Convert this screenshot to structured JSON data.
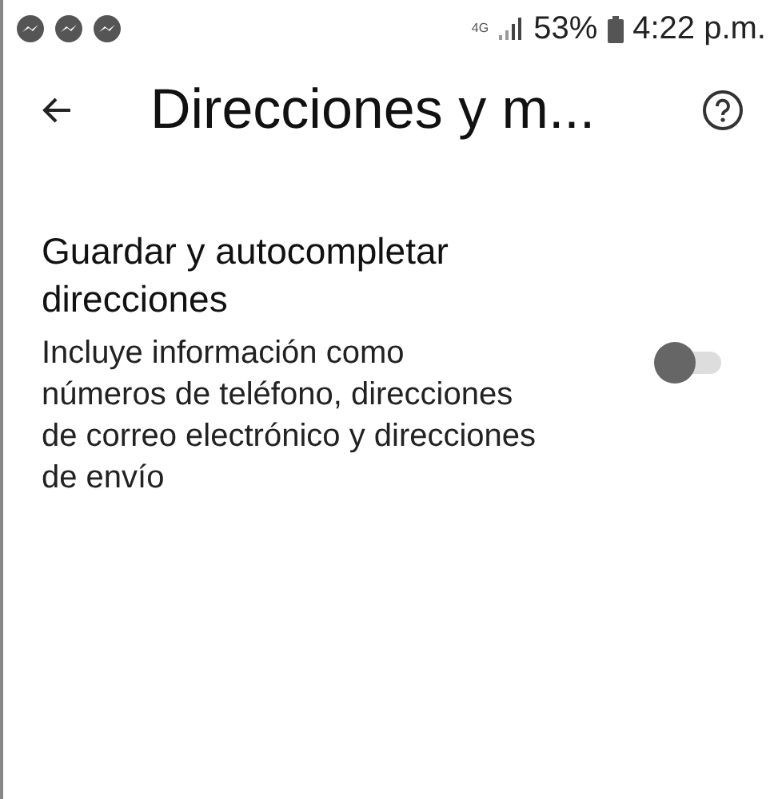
{
  "status_bar": {
    "network": "4G",
    "battery": "53%",
    "time": "4:22 p.m.",
    "notifications": [
      {
        "kind": "messenger"
      },
      {
        "kind": "messenger"
      },
      {
        "kind": "messenger"
      }
    ]
  },
  "app_bar": {
    "title": "Direcciones y m..."
  },
  "setting": {
    "title": "Guardar y autocompletar direcciones",
    "description": "Incluye información como números de teléfono, direcciones de correo electrónico y direcciones de envío",
    "on": false
  }
}
